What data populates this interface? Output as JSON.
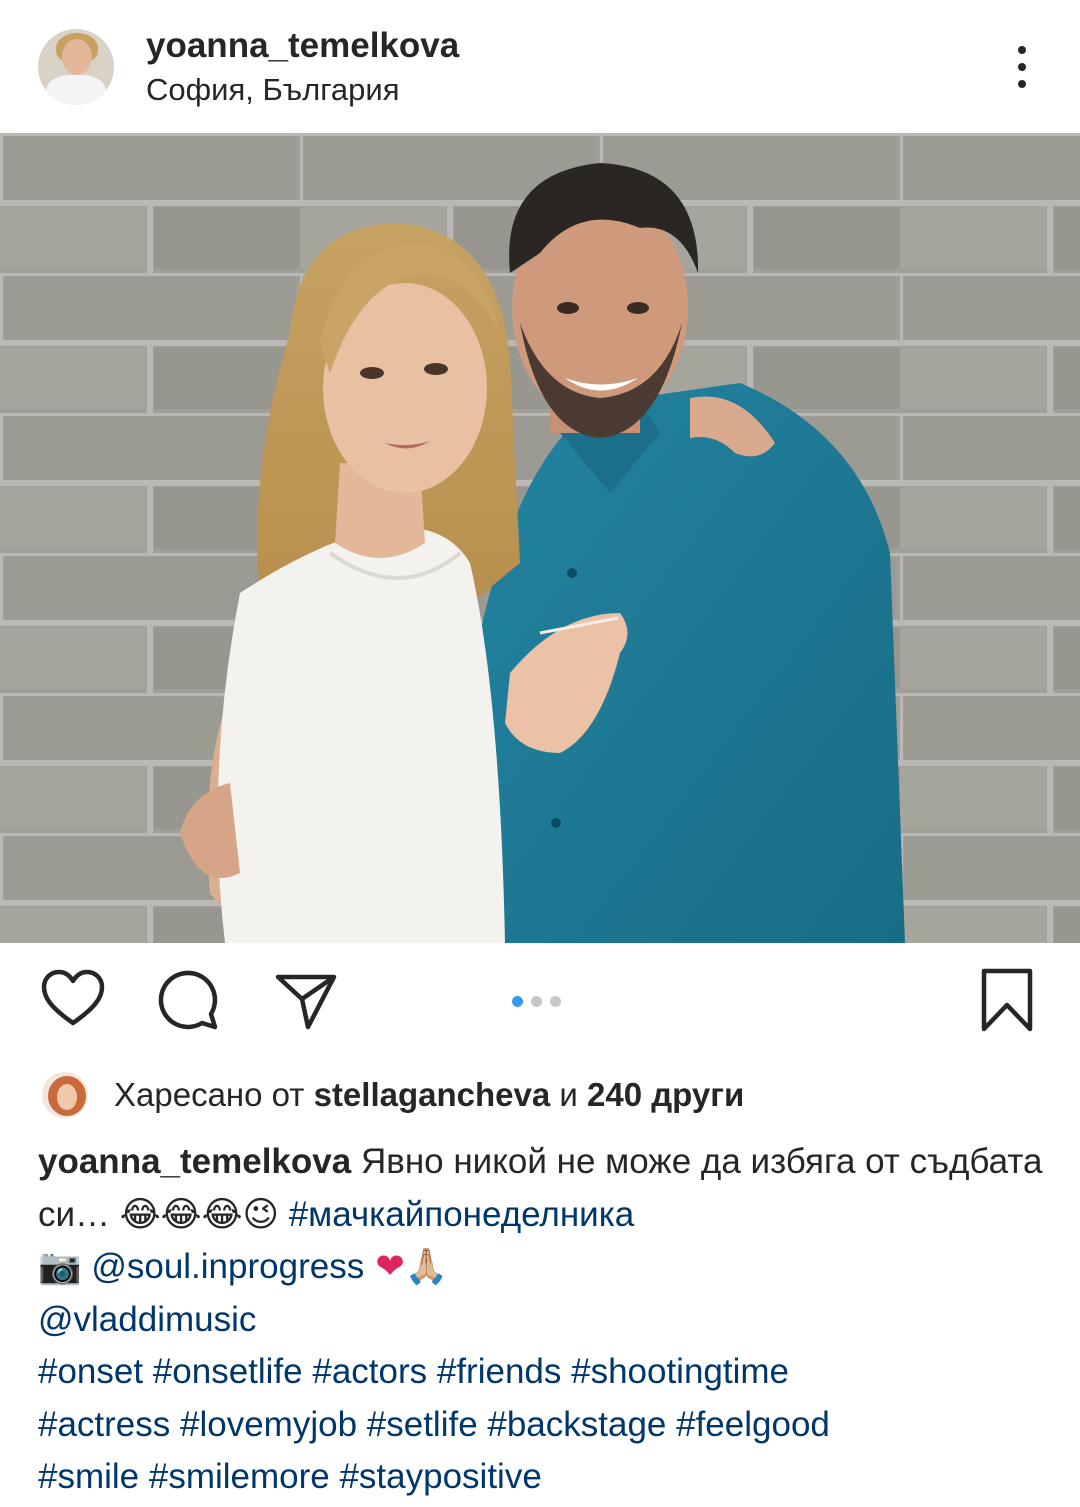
{
  "post": {
    "username": "yoanna_temelkova",
    "location": "София, България"
  },
  "carousel": {
    "slide_count": 3,
    "active_index": 0
  },
  "likes": {
    "prefix": "Харесано от ",
    "liker": "stellagancheva",
    "middle": " и ",
    "others": "240 други"
  },
  "caption": {
    "username": "yoanna_temelkova",
    "text": " Явно никой не може да избяга от съдбата си… ",
    "emojis1": "😂😂😂😉",
    "hashtag1": " #мачкайпонеделника",
    "camera": "📷",
    "mention1": " @soul.inprogress",
    "emojis2": " ❤🙏🏼",
    "mention2": "@vladdimusic",
    "hashtags_line1": "#onset #onsetlife #actors #friends #shootingtime",
    "hashtags_line2": "#actress #lovemyjob #setlife #backstage #feelgood",
    "hashtags_line3": "#smile #smilemore #staypositive"
  },
  "colors": {
    "text": "#262626",
    "link": "#00376b",
    "dot_active": "#3897f0",
    "dot_inactive": "#c7c7c7",
    "wall": "#9d9c95",
    "shirt": "#1f7a97"
  },
  "icons": [
    "more-options-icon",
    "heart-icon",
    "comment-icon",
    "share-icon",
    "bookmark-icon"
  ]
}
